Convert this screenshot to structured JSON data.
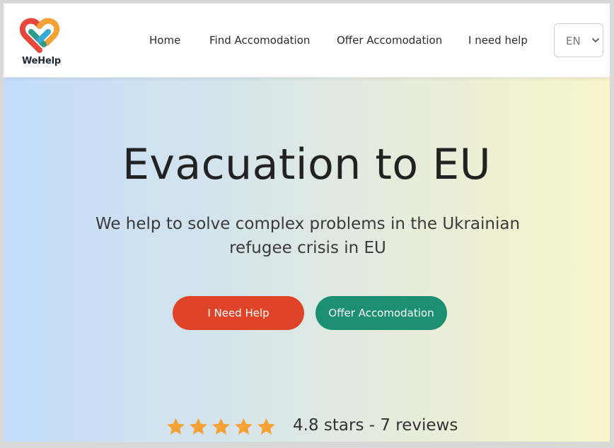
{
  "brand": {
    "name": "WeHelp"
  },
  "nav": {
    "links": [
      {
        "label": "Home"
      },
      {
        "label": "Find Accomodation"
      },
      {
        "label": "Offer Accomodation"
      },
      {
        "label": "I need help"
      }
    ],
    "language": {
      "selected": "EN"
    }
  },
  "hero": {
    "title": "Evacuation to EU",
    "subtitle": "We help to solve complex problems in the Ukrainian refugee crisis in EU",
    "primary_button": "I Need Help",
    "secondary_button": "Offer Accomodation"
  },
  "rating": {
    "stars": 5,
    "text": "4.8 stars - 7 reviews"
  },
  "colors": {
    "primary_button": "#e04428",
    "secondary_button": "#1c8e72",
    "star": "#f4a233"
  }
}
